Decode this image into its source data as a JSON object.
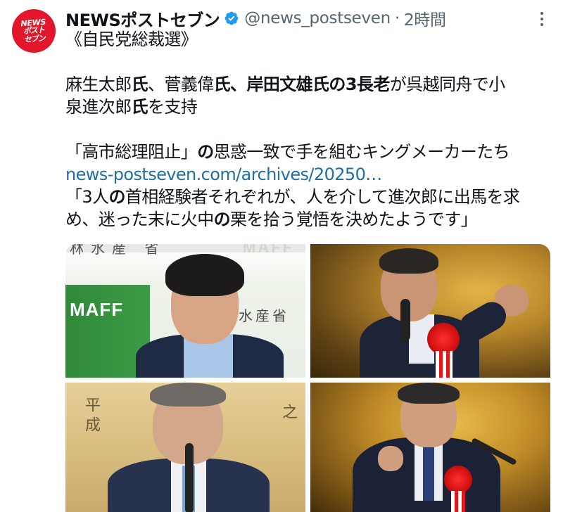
{
  "account": {
    "avatar_line1": "NEWS",
    "avatar_line2": "ポスト",
    "avatar_line3": "セブン",
    "display_name": "NEWSポストセブン",
    "handle": "@news_postseven",
    "separator": "·",
    "time": "2時間"
  },
  "tweet": {
    "line1": "《自民党総裁選》",
    "line2": {
      "s1": "麻生太郎",
      "s2": "氏",
      "s3": "、菅義偉",
      "s4": "氏",
      "s5": "、",
      "s6": "岸田文雄氏の3長老",
      "s7": "が呉越同舟で小"
    },
    "line3": {
      "s1": "泉進次郎",
      "s2": "氏",
      "s3": "を支持"
    },
    "line4": {
      "s1": "「高市総理阻止」",
      "s2": "の",
      "s3": "思惑一致で手を組むキングメーカーたち"
    },
    "link": "news-postseven.com/archives/20250…",
    "line6": {
      "s1": "「3人",
      "s2": "の",
      "s3": "首相経験者それぞれが、人を介して進次郎に出馬を求"
    },
    "line7": {
      "s1": "め、迷った末に火中",
      "s2": "の",
      "s3": "栗を拾う覚悟を決めたようです」"
    }
  },
  "media": {
    "photo1_sign_left": "MAFF",
    "photo1_sign_right": "林水産省",
    "photo1_top_text": "林水産 省",
    "photo1_top_right": "MAFF",
    "photo3_calligraphy_a": "平成",
    "photo3_calligraphy_b": "之"
  },
  "colors": {
    "avatar_bg": "#e3172c",
    "verified": "#1d9bf0",
    "link": "#1d6fa5",
    "secondary_text": "#536471"
  }
}
